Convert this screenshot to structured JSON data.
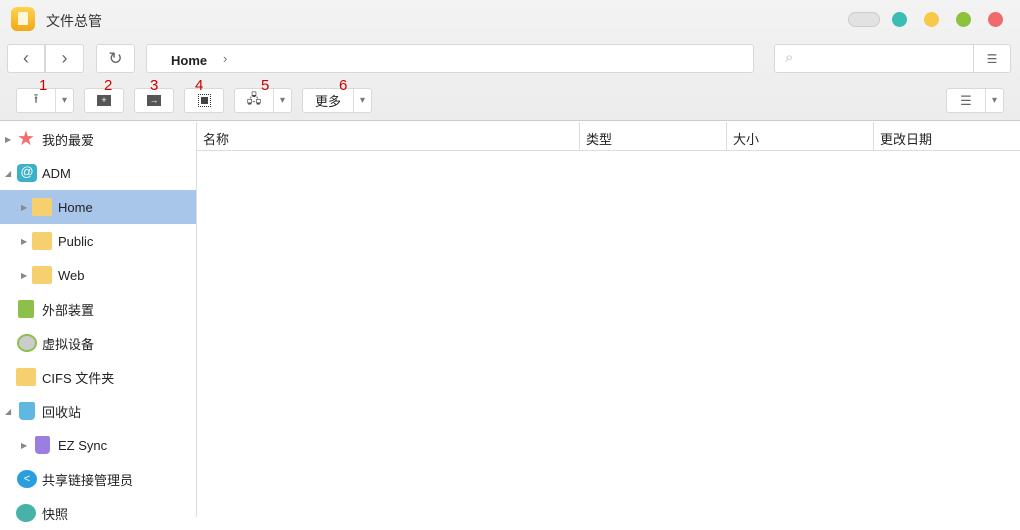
{
  "window": {
    "title": "文件总管",
    "controls": [
      "#e2e2e2",
      "#3bbdb5",
      "#f7c948",
      "#8dc23f",
      "#f06b6b"
    ]
  },
  "nav": {
    "breadcrumb": "Home",
    "search_placeholder": ""
  },
  "toolbar": {
    "numbers": [
      "1",
      "2",
      "3",
      "4",
      "5",
      "6"
    ],
    "more_label": "更多"
  },
  "sidebar": {
    "items": [
      {
        "label": "我的最爱"
      },
      {
        "label": "ADM"
      },
      {
        "label": "Home"
      },
      {
        "label": "Public"
      },
      {
        "label": "Web"
      },
      {
        "label": "外部装置"
      },
      {
        "label": "虚拟设备"
      },
      {
        "label": "CIFS 文件夹"
      },
      {
        "label": "回收站"
      },
      {
        "label": "EZ Sync"
      },
      {
        "label": "共享链接管理员"
      },
      {
        "label": "快照"
      }
    ]
  },
  "columns": [
    "名称",
    "类型",
    "大小",
    "更改日期"
  ]
}
